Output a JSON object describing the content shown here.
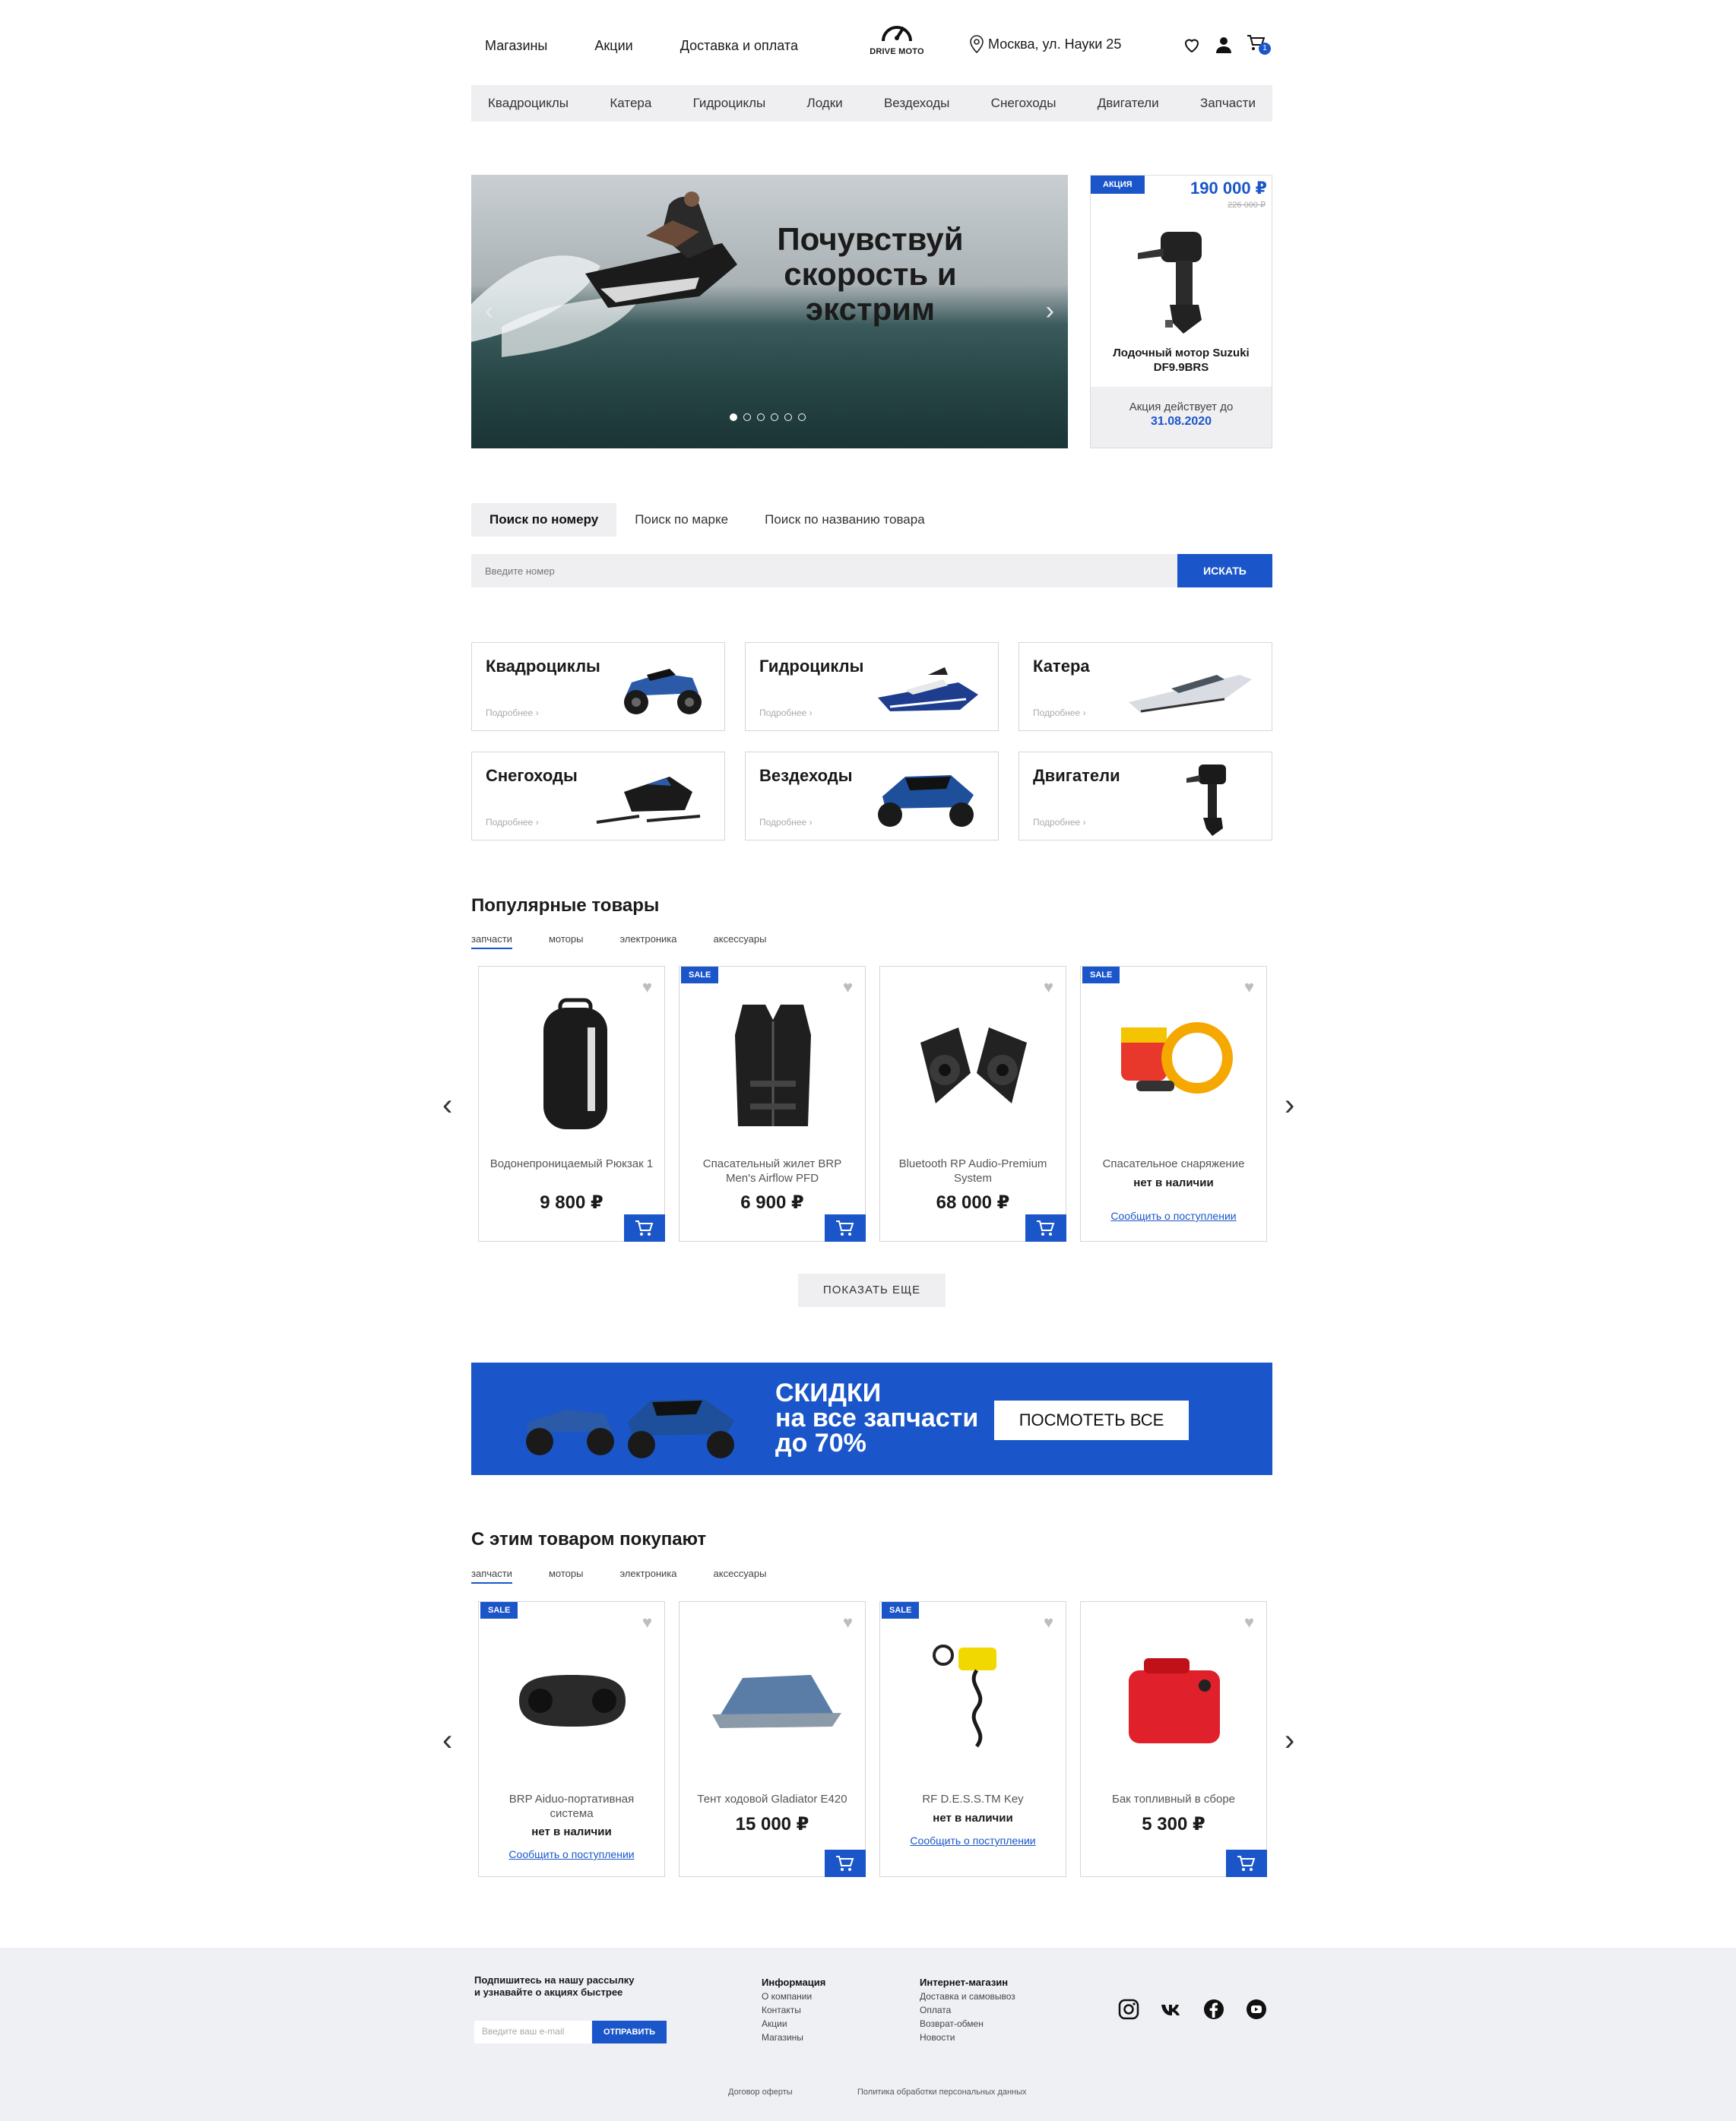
{
  "header": {
    "nav": [
      "Магазины",
      "Акции",
      "Доставка и оплата"
    ],
    "logo_text": "DRIVE MOTO",
    "address": "Москва, ул. Науки 25",
    "cart_count": "1"
  },
  "categories_bar": [
    "Квадроциклы",
    "Катера",
    "Гидроциклы",
    "Лодки",
    "Вездеходы",
    "Снегоходы",
    "Двигатели",
    "Запчасти"
  ],
  "hero": {
    "title": "Почувствуй скорость и экстрим",
    "slides": 6,
    "active_slide": 1
  },
  "promo": {
    "tag": "АКЦИЯ",
    "price": "190 000 ₽",
    "old_price": "226 000 ₽",
    "name": "Лодочный мотор Suzuki DF9.9BRS",
    "valid_label": "Акция действует до",
    "valid_date": "31.08.2020"
  },
  "search": {
    "tabs": [
      "Поиск по номеру",
      "Поиск по марке",
      "Поиск по названию товара"
    ],
    "placeholder": "Введите номер",
    "button": "ИСКАТЬ"
  },
  "category_cards": [
    {
      "name": "Квадроциклы",
      "more": "Подробнее ›",
      "icon": "atv-icon"
    },
    {
      "name": "Гидроциклы",
      "more": "Подробнее ›",
      "icon": "jetski-icon"
    },
    {
      "name": "Катера",
      "more": "Подробнее ›",
      "icon": "boat-icon"
    },
    {
      "name": "Снегоходы",
      "more": "Подробнее ›",
      "icon": "snowmobile-icon"
    },
    {
      "name": "Вездеходы",
      "more": "Подробнее ›",
      "icon": "buggy-icon"
    },
    {
      "name": "Двигатели",
      "more": "Подробнее ›",
      "icon": "outboard-motor-icon"
    }
  ],
  "popular": {
    "title": "Популярные товары",
    "tabs": [
      "запчасти",
      "моторы",
      "электроника",
      "аксессуары"
    ],
    "products": [
      {
        "name": "Водонепроницаемый Рюкзак 1",
        "price": "9 800 ₽",
        "sale": false,
        "in_stock": true
      },
      {
        "name": "Спасательный жилет BRP Men's Airflow PFD",
        "price": "6 900 ₽",
        "sale": true,
        "in_stock": true
      },
      {
        "name": "Bluetooth RP Audio-Premium System",
        "price": "68 000 ₽",
        "sale": false,
        "in_stock": true
      },
      {
        "name": "Спасательное снаряжение",
        "status": "нет в наличии",
        "notify": "Сообщить о поступлении",
        "sale": true,
        "in_stock": false
      }
    ],
    "sale_label": "SALE",
    "more_button": "ПОКАЗАТЬ ЕЩЕ"
  },
  "banner": {
    "title": "СКИДКИ",
    "line2": "на все запчасти",
    "line3": "до 70%",
    "button": "ПОСМОТЕТЬ ВСЕ"
  },
  "related": {
    "title": "С этим товаром покупают",
    "tabs": [
      "запчасти",
      "моторы",
      "электроника",
      "аксессуары"
    ],
    "products": [
      {
        "name": "BRP Aiduo-портативная система",
        "status": "нет в наличии",
        "notify": "Сообщить о поступлении",
        "sale": true,
        "in_stock": false
      },
      {
        "name": "Тент ходовой Gladiator E420",
        "price": "15 000 ₽",
        "sale": false,
        "in_stock": true
      },
      {
        "name": "RF D.E.S.S.TM Key",
        "status": "нет в наличии",
        "notify": "Сообщить о поступлении",
        "sale": true,
        "in_stock": false
      },
      {
        "name": "Бак топливный в сборе",
        "price": "5 300 ₽",
        "sale": false,
        "in_stock": true
      }
    ]
  },
  "footer": {
    "subscribe_line1": "Подпишитесь на нашу рассылку",
    "subscribe_line2": "и узнавайте о акциях быстрее",
    "email_placeholder": "Введите ваш e-mail",
    "subscribe_button": "ОТПРАВИТЬ",
    "info_title": "Информация",
    "info_links": [
      "О компании",
      "Контакты",
      "Акции",
      "Магазины"
    ],
    "shop_title": "Интернет-магазин",
    "shop_links": [
      "Доставка и самовывоз",
      "Оплата",
      "Возврат-обмен",
      "Новости"
    ],
    "social": [
      "instagram-icon",
      "vk-icon",
      "facebook-icon",
      "youtube-icon"
    ],
    "offer": "Договор оферты",
    "privacy": "Политика обработки персональных данных"
  },
  "colors": {
    "accent": "#1a56c9",
    "light_bg": "#efeff2"
  }
}
